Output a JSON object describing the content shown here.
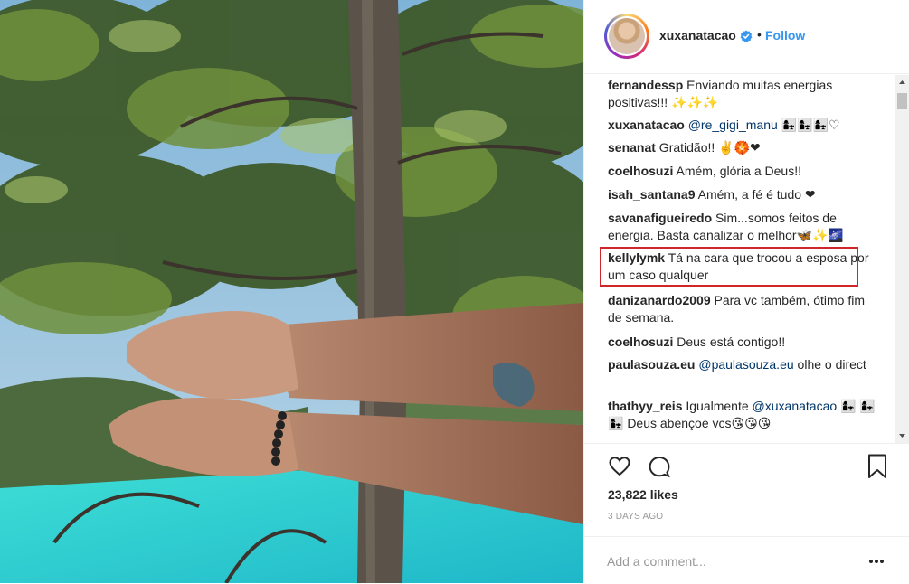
{
  "post": {
    "username": "xuxanatacao",
    "follow_label": "Follow",
    "separator": "•",
    "likes": "23,822 likes",
    "time_ago": "3 DAYS AGO",
    "add_comment_placeholder": "Add a comment..."
  },
  "comments": [
    {
      "user": "fernandessp",
      "text": " Enviando muitas energias positivas!!! ✨✨✨"
    },
    {
      "user": "xuxanatacao",
      "mention": " @re_gigi_manu",
      "text": " 👩‍👧👩‍👧👩‍👧♡"
    },
    {
      "user": "senanat",
      "text": " Gratidão!! ✌️🏵️❤"
    },
    {
      "user": "coelhosuzi",
      "text": " Amém, glória a Deus!!"
    },
    {
      "user": "isah_santana9",
      "text": " Amém, a fé é tudo ❤"
    },
    {
      "user": "savanafigueiredo",
      "text": " Sim...somos feitos de energia. Basta canalizar o melhor🦋✨🌌"
    },
    {
      "user": "kellylymk",
      "text": " Tá na cara que trocou a esposa por um caso qualquer"
    },
    {
      "user": "danizanardo2009",
      "text": " Para vc também, ótimo fim de semana."
    },
    {
      "user": "coelhosuzi",
      "text": " Deus está contigo!!"
    },
    {
      "user": "paulasouza.eu",
      "mention": " @paulasouza.eu",
      "text": " olhe o direct"
    },
    {
      "user": "thathyy_reis",
      "text": " Igualmente",
      "mention2": " @xuxanatacao",
      "text2": " 👩‍👧 👩‍👧👩‍👧 Deus abençoe vcs😘😘😘"
    }
  ],
  "colors": {
    "accent": "#3897f0",
    "highlight_border": "#d0262b",
    "mention": "#003569"
  }
}
